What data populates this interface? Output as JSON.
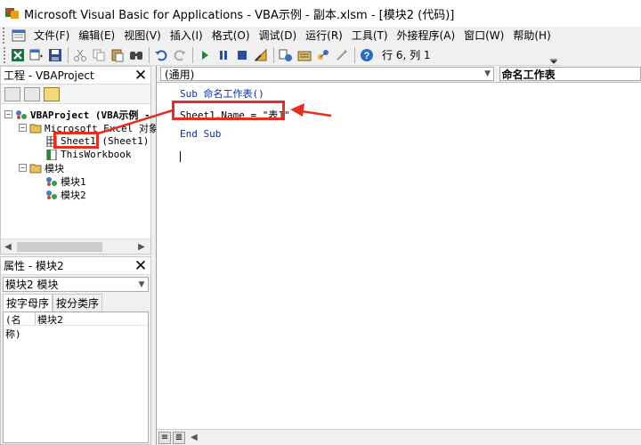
{
  "window": {
    "title": "Microsoft Visual Basic for Applications - VBA示例 - 副本.xlsm - [模块2 (代码)]"
  },
  "menu": {
    "items": [
      {
        "label": "文件(F)"
      },
      {
        "label": "编辑(E)"
      },
      {
        "label": "视图(V)"
      },
      {
        "label": "插入(I)"
      },
      {
        "label": "格式(O)"
      },
      {
        "label": "调试(D)"
      },
      {
        "label": "运行(R)"
      },
      {
        "label": "工具(T)"
      },
      {
        "label": "外接程序(A)"
      },
      {
        "label": "窗口(W)"
      },
      {
        "label": "帮助(H)"
      }
    ]
  },
  "toolbar": {
    "cursor_position": "行 6, 列 1",
    "icons": [
      "excel-view-icon",
      "insert-userform-icon",
      "save-icon",
      "cut-icon",
      "copy-icon",
      "paste-icon",
      "find-icon",
      "undo-icon",
      "redo-icon",
      "run-icon",
      "break-icon",
      "reset-icon",
      "design-mode-icon",
      "project-explorer-icon",
      "properties-window-icon",
      "object-browser-icon",
      "toolbox-icon",
      "help-icon"
    ]
  },
  "project_pane": {
    "title": "工程 - VBAProject",
    "tree": {
      "root": "VBAProject (VBA示例 -",
      "excel_objects_folder": "Microsoft Excel 对象",
      "sheet1": "Sheet1 (Sheet1)",
      "thisworkbook": "ThisWorkbook",
      "modules_folder": "模块",
      "module1": "模块1",
      "module2": "模块2"
    }
  },
  "properties_pane": {
    "title": "属性 - 模块2",
    "object_select": "模块2 模块",
    "tabs": [
      "按字母序",
      "按分类序"
    ],
    "rows": [
      {
        "name": "(名称)",
        "value": "模块2"
      }
    ]
  },
  "code_window": {
    "object_combo": "(通用)",
    "procedure_combo": "命名工作表",
    "lines": {
      "sub_keyword": "Sub",
      "sub_name": " 命名工作表()",
      "statement": "Sheet1.Name = \"表1\"",
      "end_sub": "End Sub"
    }
  },
  "colors": {
    "annotation_red": "#e52d22",
    "keyword_blue": "#0b2ea8"
  }
}
